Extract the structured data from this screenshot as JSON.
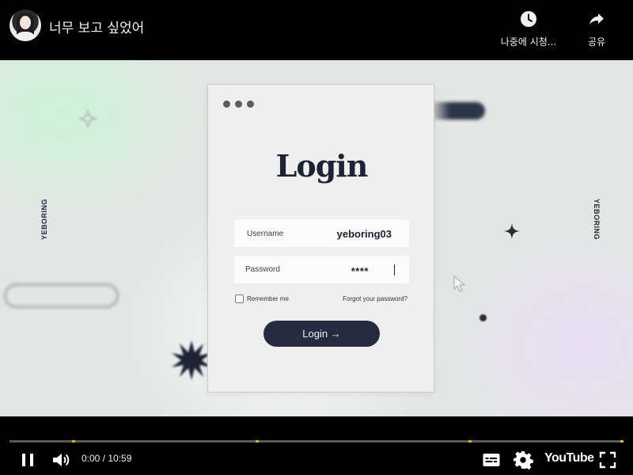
{
  "header": {
    "title": "너무 보고 싶었어",
    "watch_later_label": "나중에 시청...",
    "share_label": "공유"
  },
  "video": {
    "side_label_left": "YEBORING",
    "side_label_right": "YEBORING",
    "login_card": {
      "title": "Login",
      "username_label": "Username",
      "username_value": "yeboring03",
      "password_label": "Password",
      "password_value": "****",
      "remember_label": "Remember me",
      "forgot_label": "Forgot your password?",
      "button_label": "Login →"
    },
    "colors": {
      "ink": "#1d2234",
      "button": "#262b3f",
      "card": "#efefef"
    }
  },
  "player": {
    "time_display": "0:00 / 10:59",
    "logo_text": "YouTube",
    "progress_fraction": 0.0,
    "chapter_marker_times": [
      "0:11",
      "4:30",
      "8:17"
    ],
    "icons": [
      "pause-icon",
      "volume-icon",
      "subtitles-icon",
      "settings-icon",
      "fullscreen-icon"
    ]
  }
}
